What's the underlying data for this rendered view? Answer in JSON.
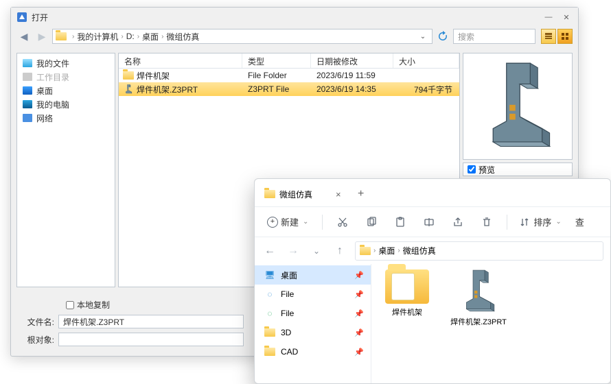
{
  "dlg": {
    "title": "打开",
    "nav": {
      "back": "◄",
      "fwd": "►"
    },
    "breadcrumb": [
      "我的计算机",
      "D:",
      "桌面",
      "微组仿真"
    ],
    "search_placeholder": "搜索",
    "sidebar": [
      {
        "label": "我的文件",
        "ico": "ico-docs",
        "dim": false
      },
      {
        "label": "工作目录",
        "ico": "ico-gray",
        "dim": true
      },
      {
        "label": "桌面",
        "ico": "ico-desk",
        "dim": false
      },
      {
        "label": "我的电脑",
        "ico": "ico-pc",
        "dim": false
      },
      {
        "label": "网络",
        "ico": "ico-net",
        "dim": false
      }
    ],
    "columns": {
      "name": "名称",
      "type": "类型",
      "date": "日期被修改",
      "size": "大小"
    },
    "rows": [
      {
        "name": "焊件机架",
        "type": "File Folder",
        "date": "2023/6/19 11:59",
        "size": "",
        "kind": "folder",
        "selected": false
      },
      {
        "name": "焊件机架.Z3PRT",
        "type": "Z3PRT File",
        "date": "2023/6/19 14:35",
        "size": "794千字节",
        "kind": "part",
        "selected": true
      }
    ],
    "preview_label": "预览",
    "preview_checked": true,
    "local_copy_label": "本地复制",
    "file_label": "文件名:",
    "file_value": "焊件机架.Z3PRT",
    "root_label": "根对象:",
    "root_value": ""
  },
  "exp": {
    "tab_title": "微组仿真",
    "new_label": "新建",
    "sort_label": "排序",
    "view_label": "查",
    "breadcrumb": [
      "桌面",
      "微组仿真"
    ],
    "sidebar": [
      {
        "label": "桌面",
        "ico": "desk",
        "pinned": true,
        "sel": true
      },
      {
        "label": "File",
        "ico": "fblue",
        "pinned": true,
        "sel": false
      },
      {
        "label": "File",
        "ico": "fgreen",
        "pinned": true,
        "sel": false
      },
      {
        "label": "3D",
        "ico": "folder",
        "pinned": true,
        "sel": false
      },
      {
        "label": "CAD",
        "ico": "folder",
        "pinned": true,
        "sel": false
      }
    ],
    "tiles": [
      {
        "label": "焊件机架",
        "kind": "folder"
      },
      {
        "label": "焊件机架.Z3PRT",
        "kind": "part"
      }
    ]
  }
}
